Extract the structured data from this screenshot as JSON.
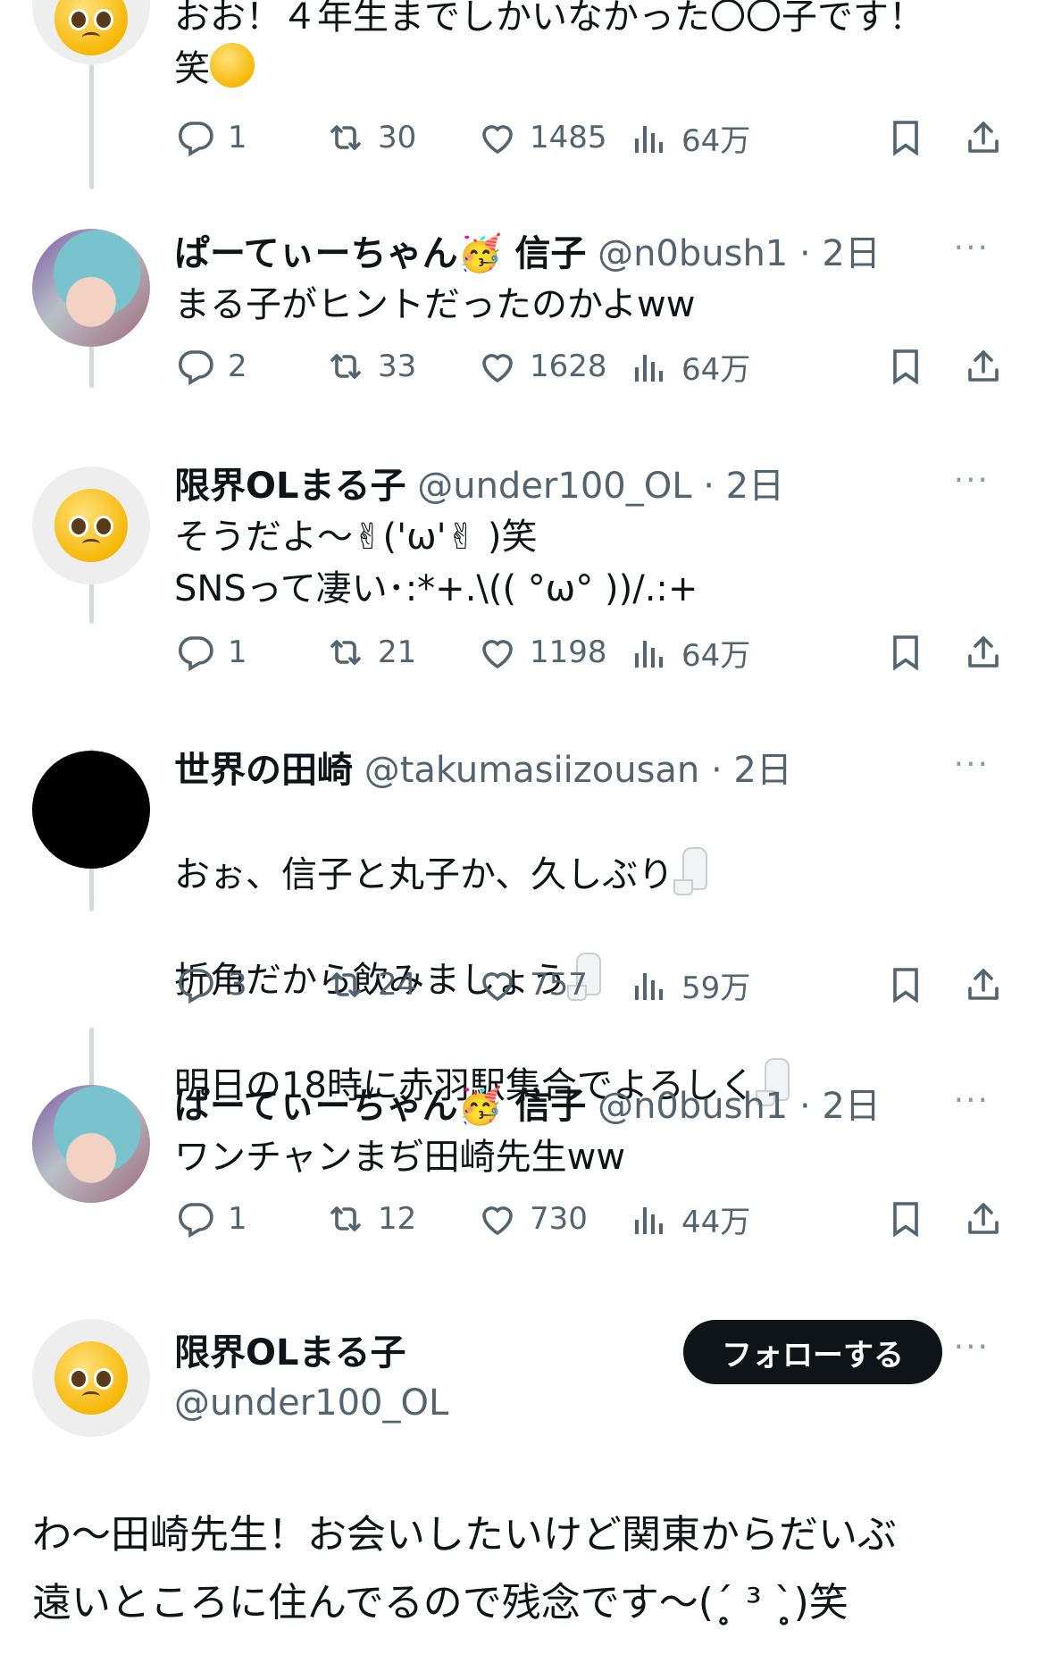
{
  "tweets": [
    {
      "body": "おお！４年生までしかいなかった〇〇子です！\n笑",
      "trailing_emoji": "star-struck-emoji",
      "replies": "1",
      "retweets": "30",
      "likes": "1485",
      "views": "64万"
    },
    {
      "name": "ぱーてぃーちゃん🥳 信子",
      "handle": "@n0bush1 · 2日",
      "body": "まる子がヒントだったのかよww",
      "replies": "2",
      "retweets": "33",
      "likes": "1628",
      "views": "64万"
    },
    {
      "name": "限界OLまる子",
      "handle": "@under100_OL · 2日",
      "body": "そうだよ〜✌('ω'✌ )笑\nSNSって凄い･:*+.\\(( °ω° ))/.:+",
      "replies": "1",
      "retweets": "21",
      "likes": "1198",
      "views": "64万"
    },
    {
      "name": "世界の田崎",
      "handle": "@takumasiizousan · 2日",
      "lines": [
        "おぉ、信子と丸子か、久しぶり",
        "折角だから飲みましょう",
        "明日の18時に赤羽駅集合でよろしく"
      ],
      "replies": "3",
      "retweets": "24",
      "likes": "757",
      "views": "59万"
    },
    {
      "name": "ぱーてぃーちゃん🥳 信子",
      "handle": "@n0bush1 · 2日",
      "body": "ワンチャンまぢ田崎先生ww",
      "replies": "1",
      "retweets": "12",
      "likes": "730",
      "views": "44万"
    }
  ],
  "main_tweet": {
    "name": "限界OLまる子",
    "handle": "@under100_OL",
    "follow_label": "フォローする",
    "body": "わ〜田崎先生！お会いしたいけど関東からだいぶ\n遠いところに住んでるので残念です〜(ˊ̥̥̥̥̥ ³ ˋ̥̥̥̥̥)笑"
  },
  "more_label": "···",
  "colors": {
    "text": "#0f1419",
    "secondary": "#536471",
    "thread_line": "#cfd9de",
    "button": "#0f1419"
  }
}
